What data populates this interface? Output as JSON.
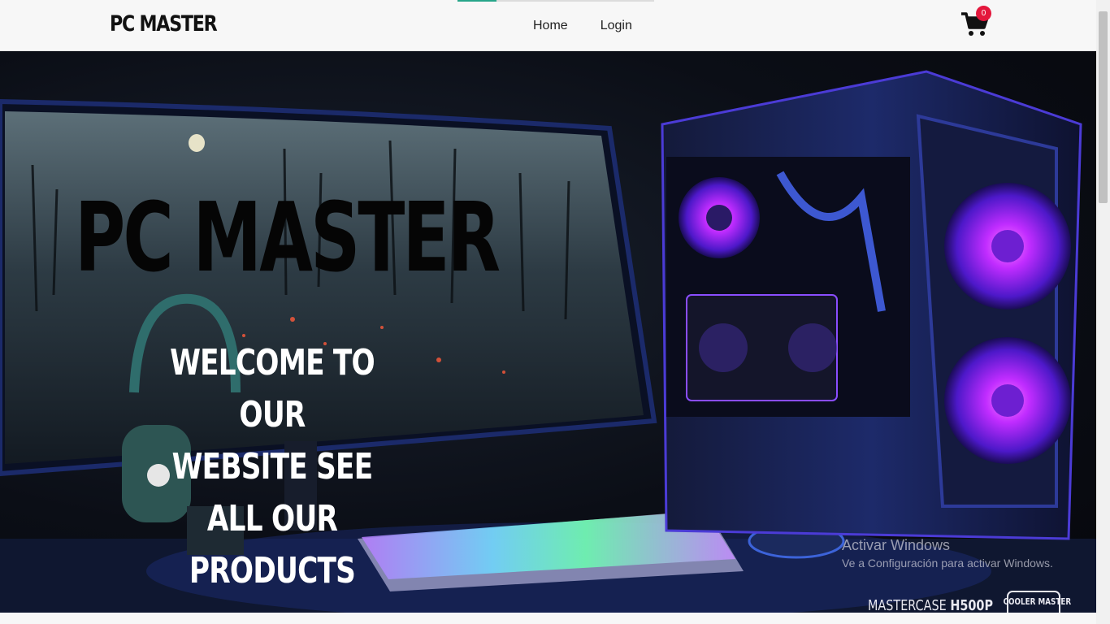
{
  "header": {
    "brand": "PC MASTER",
    "nav": [
      {
        "label": "Home"
      },
      {
        "label": "Login"
      }
    ],
    "cart": {
      "count": "0",
      "icon": "shopping-cart-icon"
    }
  },
  "hero": {
    "title": "PC MASTER",
    "subtitle_lines": [
      "WELCOME TO OUR",
      "WEBSITE SEE ALL OUR",
      "PRODUCTS"
    ],
    "product_brand_prefix": "MASTERCASE",
    "product_model": "H500P",
    "product_logo_text": "COOLER MASTER"
  },
  "windows_watermark": {
    "title": "Activar Windows",
    "subtitle": "Ve a Configuración para activar Windows."
  },
  "colors": {
    "accent": "#27a58a",
    "badge": "#e4173c",
    "hero_purple": "#7a2cff",
    "hero_blue": "#2c6bff"
  }
}
